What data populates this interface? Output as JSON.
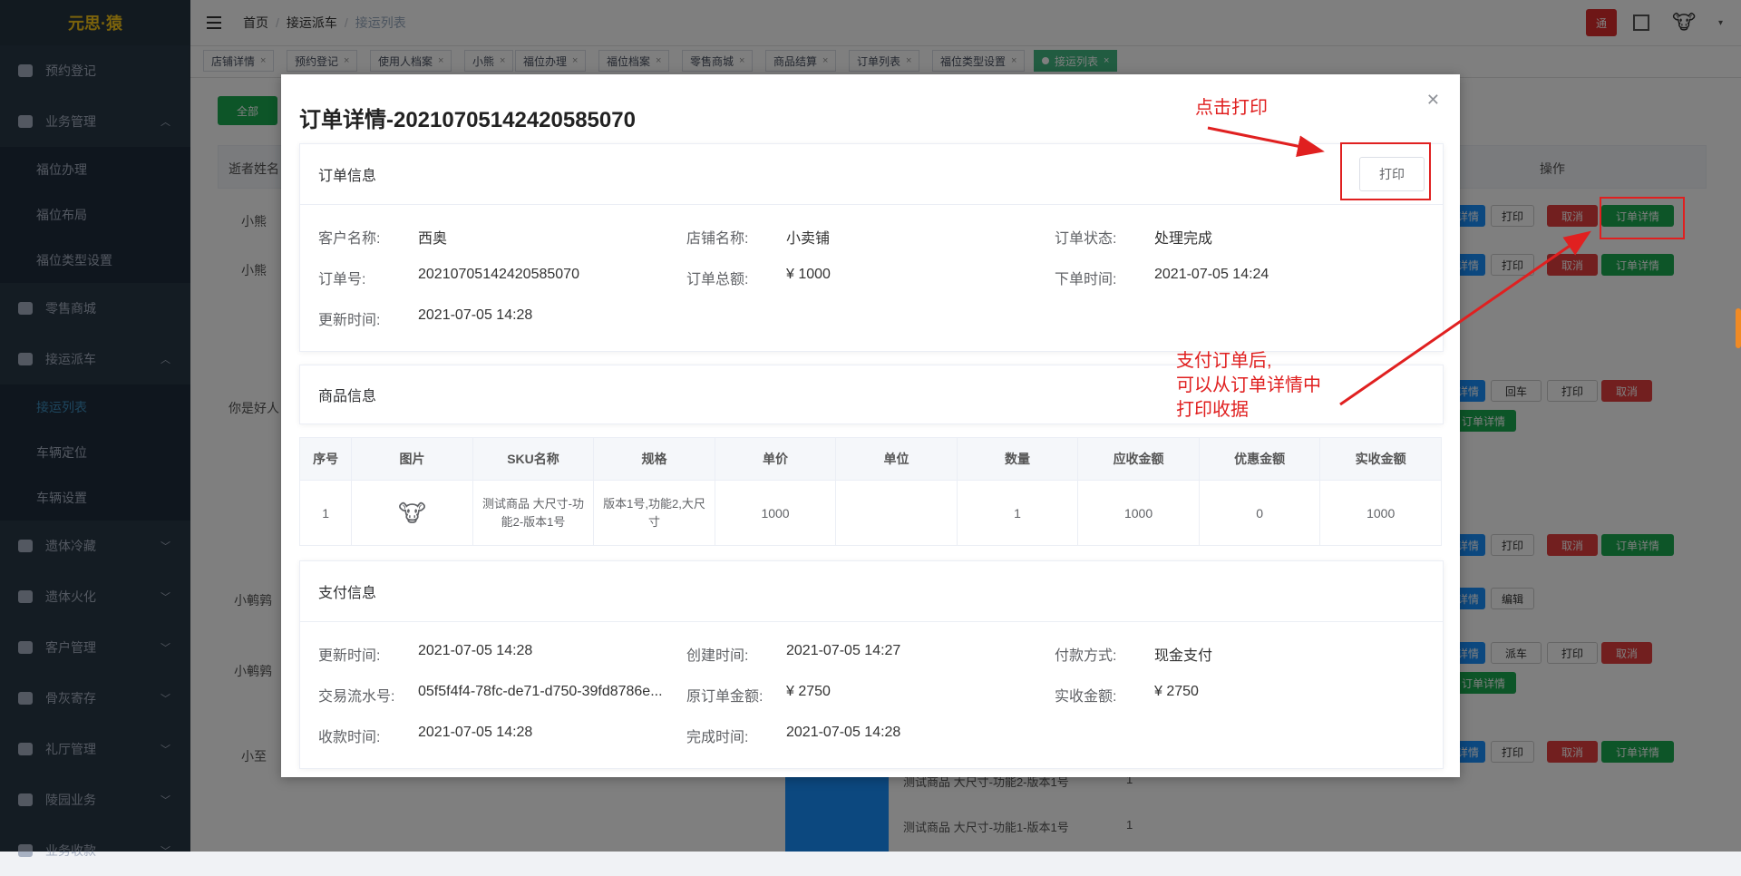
{
  "brand": {
    "logo_text": "元思·猿"
  },
  "sidebar": {
    "items": [
      {
        "label": "预约登记",
        "icon": "dashboard-icon"
      },
      {
        "label": "业务管理",
        "icon": "check-icon"
      },
      {
        "label": "零售商城",
        "icon": "truck-icon"
      },
      {
        "label": "接运派车",
        "icon": "truck-icon"
      },
      {
        "label": "遗体冷藏",
        "icon": "temperature-icon"
      },
      {
        "label": "遗体火化",
        "icon": "fire-icon"
      },
      {
        "label": "客户管理",
        "icon": "users-icon"
      },
      {
        "label": "骨灰寄存",
        "icon": "grid-icon"
      },
      {
        "label": "礼厅管理",
        "icon": "hall-icon"
      },
      {
        "label": "陵园业务",
        "icon": "park-icon"
      },
      {
        "label": "业务收款",
        "icon": "money-icon"
      }
    ],
    "business_sub": [
      "福位办理",
      "福位布局",
      "福位类型设置"
    ],
    "transport_sub": [
      "接运列表",
      "车辆定位",
      "车辆设置"
    ]
  },
  "header": {
    "crumbs": [
      "首页",
      "接运派车",
      "接运列表"
    ],
    "bell_label": "通"
  },
  "tags": [
    {
      "label": "店铺详情"
    },
    {
      "label": "预约登记"
    },
    {
      "label": "使用人档案"
    },
    {
      "label": "小熊"
    },
    {
      "label": "福位办理"
    },
    {
      "label": "福位档案"
    },
    {
      "label": "零售商城"
    },
    {
      "label": "商品结算"
    },
    {
      "label": "订单列表"
    },
    {
      "label": "福位类型设置"
    },
    {
      "label": "接运列表"
    }
  ],
  "background": {
    "filter_all": "全部",
    "col_name": "逝者姓名",
    "col_ops": "操作",
    "names": [
      "小熊",
      "小熊",
      "你是好人",
      "小鹌鹑",
      "小鹌鹑",
      "小至"
    ],
    "btn_detail": "订单详情",
    "btn_print": "打印",
    "btn_cancel": "取消",
    "btn_return": "回车",
    "btn_dispatch": "派车",
    "btn_edit": "编辑",
    "btn_view": "详情",
    "goods_rows": [
      "测试商品 大尺寸-功能2-版本1号",
      "测试商品 大尺寸-功能1-版本1号"
    ],
    "goods_qty": "1"
  },
  "modal": {
    "title": "订单详情-20210705142420585070",
    "order_section": "订单信息",
    "print_label": "打印",
    "order_fields": [
      {
        "label": "客户名称:",
        "value": "西奥"
      },
      {
        "label": "店铺名称:",
        "value": "小卖铺"
      },
      {
        "label": "订单状态:",
        "value": "处理完成"
      },
      {
        "label": "订单号:",
        "value": "20210705142420585070"
      },
      {
        "label": "订单总额:",
        "value": "¥ 1000"
      },
      {
        "label": "下单时间:",
        "value": "2021-07-05 14:24"
      },
      {
        "label": "更新时间:",
        "value": "2021-07-05 14:28"
      }
    ],
    "goods_section": "商品信息",
    "goods_headers": [
      "序号",
      "图片",
      "SKU名称",
      "规格",
      "单价",
      "单位",
      "数量",
      "应收金额",
      "优惠金额",
      "实收金额"
    ],
    "goods_rows": [
      [
        "1",
        "",
        "测试商品 大尺寸-功能2-版本1号",
        "版本1号,功能2,大尺寸",
        "1000",
        "",
        "1",
        "1000",
        "0",
        "1000"
      ]
    ],
    "pay_section": "支付信息",
    "pay_fields": [
      {
        "label": "更新时间:",
        "value": "2021-07-05 14:28"
      },
      {
        "label": "创建时间:",
        "value": "2021-07-05 14:27"
      },
      {
        "label": "付款方式:",
        "value": "现金支付"
      },
      {
        "label": "交易流水号:",
        "value": "05f5f4f4-78fc-de71-d750-39fd8786e..."
      },
      {
        "label": "原订单金额:",
        "value": "¥ 2750"
      },
      {
        "label": "实收金额:",
        "value": "¥ 2750"
      },
      {
        "label": "收款时间:",
        "value": "2021-07-05 14:28"
      },
      {
        "label": "完成时间:",
        "value": "2021-07-05 14:28"
      }
    ]
  },
  "annotations": {
    "click_print": "点击打印",
    "note_line1": "支付订单后,",
    "note_line2": "可以从订单详情中",
    "note_line3": "打印收据"
  },
  "colors": {
    "annotation": "#e02020",
    "active_tag": "#42b983",
    "sidebar": "#293846"
  }
}
